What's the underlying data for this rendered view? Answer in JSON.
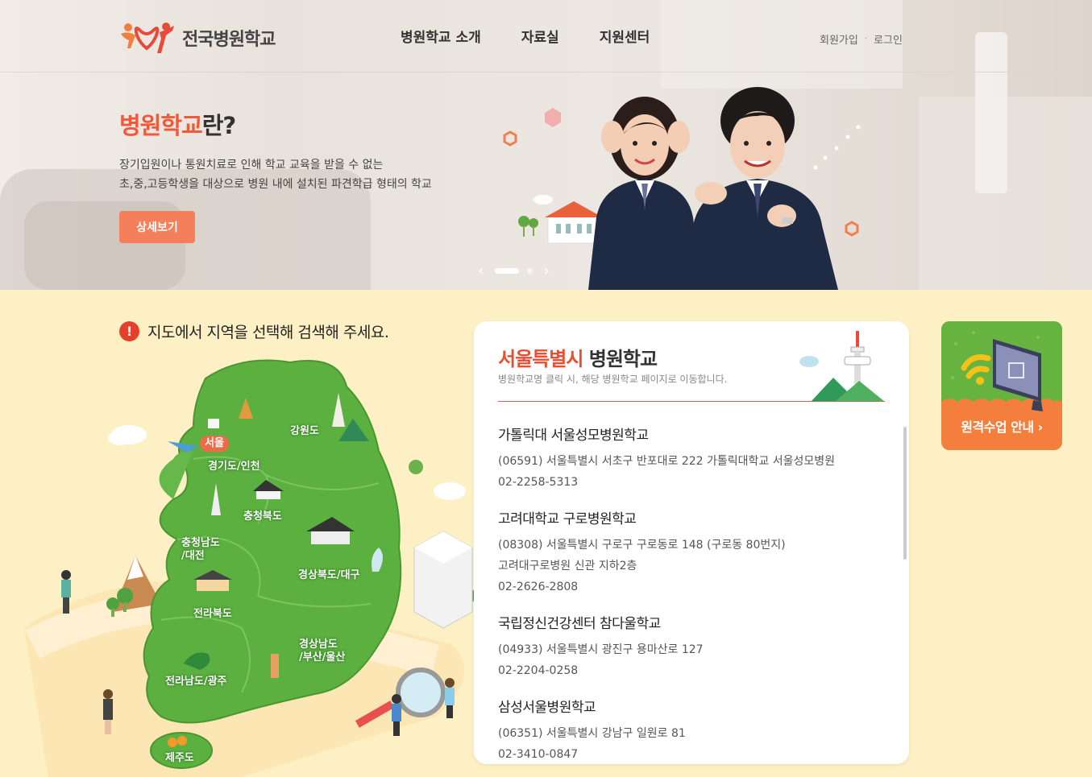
{
  "header": {
    "logo_text": "전국병원학교",
    "nav": [
      "병원학교 소개",
      "자료실",
      "지원센터"
    ],
    "util": {
      "signup": "회원가입",
      "separator": "·",
      "login": "로그인"
    }
  },
  "hero": {
    "title_highlight": "병원학교",
    "title_rest": "란?",
    "desc_line1": "장기입원이나 통원치료로 인해 학교 교육을 받을 수 없는",
    "desc_line2": "초,중,고등학생을 대상으로 병원 내에 설치된 파견학급 형태의 학교",
    "button": "상세보기",
    "slider": {
      "prev": "‹",
      "next": "›"
    }
  },
  "map": {
    "notice_icon": "!",
    "notice": "지도에서 지역을 선택해 검색해 주세요.",
    "regions": {
      "seoul": "서울",
      "gyeonggi": "경기도/인천",
      "gangwon": "강원도",
      "chungbuk": "충청북도",
      "chungnam_1": "충청남도",
      "chungnam_2": "/대전",
      "gyeongbuk": "경상북도/대구",
      "jeonbuk": "전라북도",
      "gyeongnam_1": "경상남도",
      "gyeongnam_2": "/부산/울산",
      "jeonnam": "전라남도/광주",
      "jeju": "제주도"
    }
  },
  "list": {
    "title_highlight": "서울특별시",
    "title_rest": "병원학교",
    "subtitle": "병원학교명 클릭 시, 해당 병원학교 페이지로 이동합니다.",
    "schools": [
      {
        "name": "가톨릭대 서울성모병원학교",
        "lines": [
          "(06591) 서울특별시 서초구 반포대로 222 가톨릭대학교 서울성모병원",
          "02-2258-5313"
        ]
      },
      {
        "name": "고려대학교 구로병원학교",
        "lines": [
          "(08308) 서울특별시 구로구 구로동로 148 (구로동 80번지)",
          "고려대구로병원 신관 지하2층",
          "02-2626-2808"
        ]
      },
      {
        "name": "국립정신건강센터 참다울학교",
        "lines": [
          "(04933) 서울특별시 광진구 용마산로 127",
          "02-2204-0258"
        ]
      },
      {
        "name": "삼성서울병원학교",
        "lines": [
          "(06351) 서울특별시 강남구 일원로 81",
          "02-3410-0847"
        ]
      }
    ]
  },
  "remote": {
    "label": "원격수업 안내 ›"
  },
  "colors": {
    "accent": "#ee5a3a",
    "button": "#f47f5a",
    "map_green": "#5cb040",
    "bg_yellow": "#fdf0c4",
    "remote_orange": "#f47f3c"
  }
}
